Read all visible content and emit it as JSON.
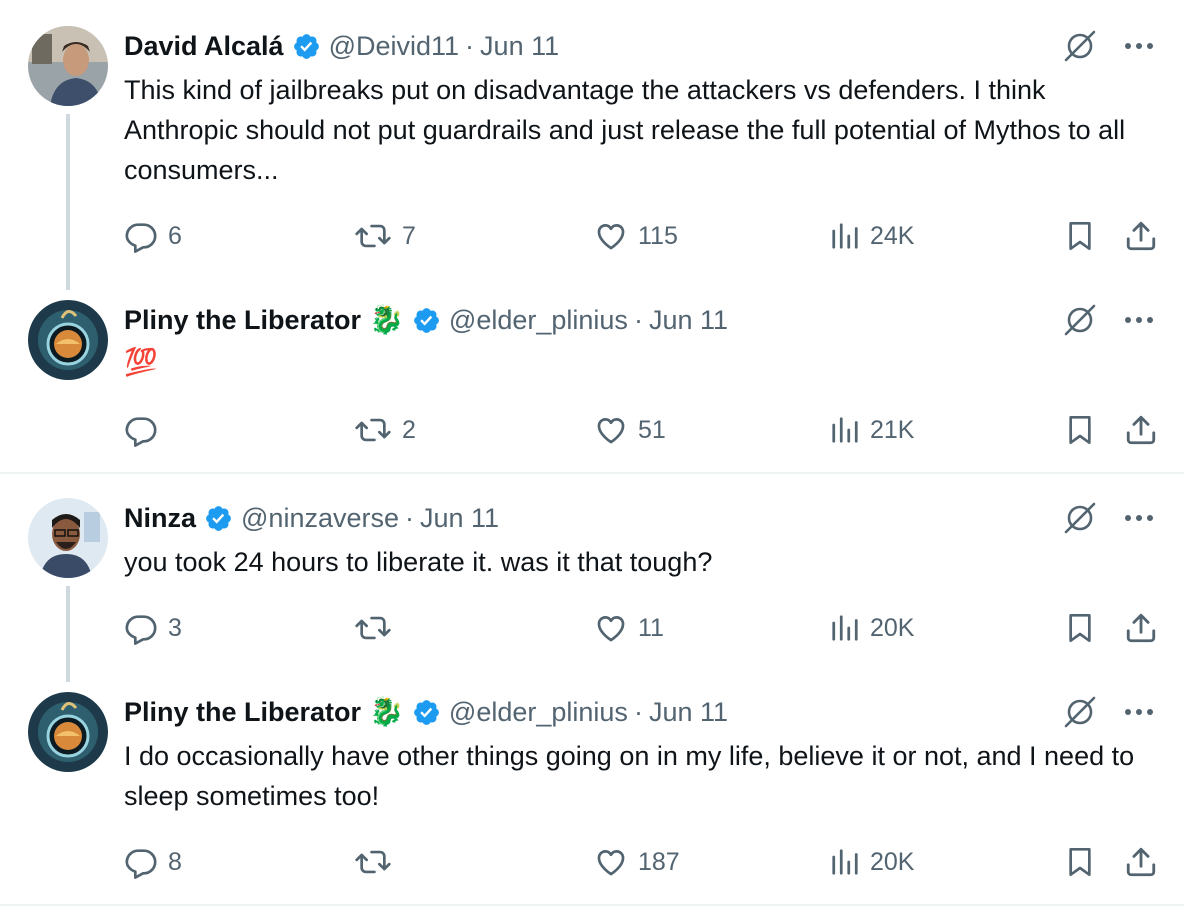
{
  "tweets": [
    {
      "name": "David Alcalá",
      "handle": "@Deivid11",
      "dot": "·",
      "date": "Jun 11",
      "text": "This kind of jailbreaks put on disadvantage the attackers vs defenders. I think Anthropic should not put guardrails and just release the full potential of Mythos to all consumers...",
      "replies": "6",
      "retweets": "7",
      "likes": "115",
      "views": "24K"
    },
    {
      "name": "Pliny the Liberator",
      "name_emoji": "🐉",
      "handle": "@elder_plinius",
      "dot": "·",
      "date": "Jun 11",
      "text": "💯",
      "replies": "",
      "retweets": "2",
      "likes": "51",
      "views": "21K"
    },
    {
      "name": "Ninza",
      "handle": "@ninzaverse",
      "dot": "·",
      "date": "Jun 11",
      "text": "you took 24 hours to liberate it. was it that tough?",
      "replies": "3",
      "retweets": "",
      "likes": "11",
      "views": "20K"
    },
    {
      "name": "Pliny the Liberator",
      "name_emoji": "🐉",
      "handle": "@elder_plinius",
      "dot": "·",
      "date": "Jun 11",
      "text": "I do occasionally have other things going on in my life, believe it or not, and I need to sleep sometimes too!",
      "replies": "8",
      "retweets": "",
      "likes": "187",
      "views": "20K"
    }
  ],
  "colors": {
    "text": "#0f1419",
    "secondary": "#536471",
    "verified": "#1d9bf0",
    "thread_line": "#cfd9de",
    "separator": "#eff3f4"
  },
  "icons": [
    "verified-badge-icon",
    "grok-icon",
    "more-icon",
    "reply-icon",
    "retweet-icon",
    "like-icon",
    "views-icon",
    "bookmark-icon",
    "share-icon"
  ]
}
